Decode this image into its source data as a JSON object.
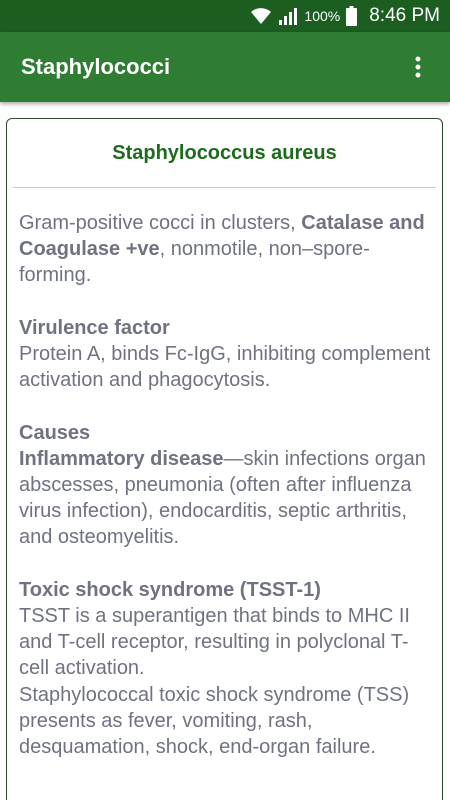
{
  "status_bar": {
    "battery": "100%",
    "time": "8:46 PM",
    "icons": [
      "wifi-icon",
      "signal-icon",
      "battery-icon"
    ]
  },
  "app_bar": {
    "title": "Staphylococci",
    "overflow_icon": "more-vert-icon"
  },
  "colors": {
    "status_bar": "#1b5e20",
    "app_bar": "#2e7d32",
    "heading": "#1e6b1e",
    "body_text": "#6f7380"
  },
  "card": {
    "title": "Staphylococcus aureus",
    "intro": {
      "text1": "Gram-positive cocci in clusters, ",
      "bold1": "Catalase and Coagulase +ve",
      "text2": ", nonmotile, non–spore-forming."
    },
    "virulence": {
      "heading": "Virulence factor",
      "text": "Protein A, binds Fc-IgG, inhibiting complement activation and phagocytosis."
    },
    "causes": {
      "heading": "Causes",
      "bold": "Inflammatory disease",
      "text": "—skin infections organ abscesses, pneumonia (often after influenza virus infection), endocarditis, septic arthritis, and osteomyelitis."
    },
    "toxic_shock": {
      "heading": "Toxic shock syndrome (TSST-1)",
      "text1": "TSST is a superantigen that binds to MHC II and T-cell receptor, resulting in polyclonal T-cell activation.",
      "text2": "Staphylococcal toxic shock syndrome (TSS) presents as fever, vomiting, rash, desquamation, shock, end-organ failure."
    }
  }
}
